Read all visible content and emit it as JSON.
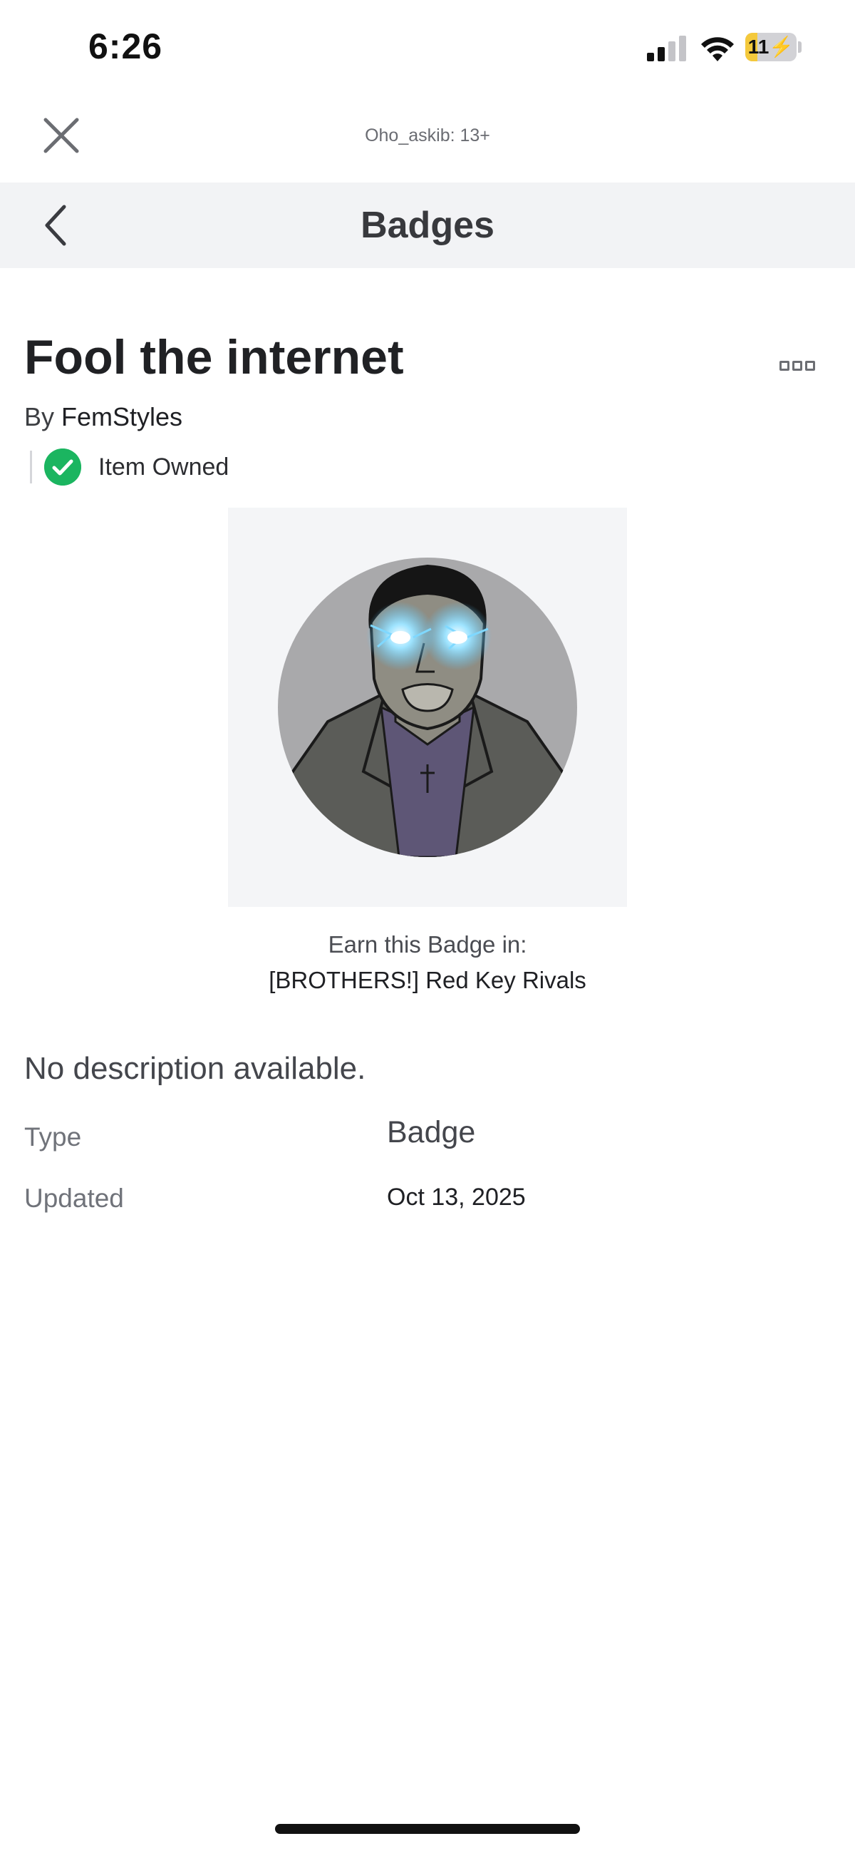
{
  "status_bar": {
    "time": "6:26",
    "battery_text": "11",
    "battery_level": 0.11,
    "signal_bars": 2,
    "icons": [
      "signal-icon",
      "wifi-icon",
      "battery-charging-icon"
    ]
  },
  "top_bar": {
    "user_label": "Oho_askib: 13+",
    "close_icon": "close-icon"
  },
  "header": {
    "title": "Badges",
    "back_icon": "chevron-left-icon"
  },
  "item": {
    "title": "Fool the internet",
    "by_prefix": "By ",
    "creator": "FemStyles",
    "owned_label": "Item Owned",
    "more_icon": "more-options-icon",
    "image_desc_icon": "badge-image"
  },
  "earn": {
    "label": "Earn this Badge in:",
    "game": "[BROTHERS!] Red Key Rivals"
  },
  "details": {
    "description": "No description available.",
    "type_label": "Type",
    "type_value": "Badge",
    "updated_label": "Updated",
    "updated_value": "Oct 13, 2025"
  },
  "colors": {
    "owned_green": "#1bb560",
    "header_bg": "#f2f3f5",
    "battery_yellow": "#f4c93c",
    "glow_blue": "#58c8ff"
  }
}
